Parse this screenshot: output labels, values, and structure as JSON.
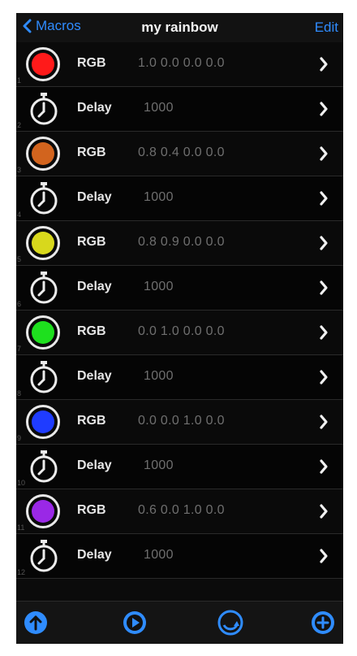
{
  "nav": {
    "back_label": "Macros",
    "title": "my rainbow",
    "edit_label": "Edit"
  },
  "rows": [
    {
      "index": "1",
      "label": "RGB",
      "value": "1.0 0.0 0.0 0.0",
      "color": "#ff1a1a",
      "icon": "color-swatch"
    },
    {
      "index": "2",
      "label": "Delay",
      "value": "1000",
      "icon": "stopwatch-icon"
    },
    {
      "index": "3",
      "label": "RGB",
      "value": "0.8 0.4 0.0 0.0",
      "color": "#d2641e",
      "icon": "color-swatch"
    },
    {
      "index": "4",
      "label": "Delay",
      "value": "1000",
      "icon": "stopwatch-icon"
    },
    {
      "index": "5",
      "label": "RGB",
      "value": "0.8 0.9 0.0 0.0",
      "color": "#d8d81c",
      "icon": "color-swatch"
    },
    {
      "index": "6",
      "label": "Delay",
      "value": "1000",
      "icon": "stopwatch-icon"
    },
    {
      "index": "7",
      "label": "RGB",
      "value": "0.0 1.0 0.0 0.0",
      "color": "#1ee01e",
      "icon": "color-swatch"
    },
    {
      "index": "8",
      "label": "Delay",
      "value": "1000",
      "icon": "stopwatch-icon"
    },
    {
      "index": "9",
      "label": "RGB",
      "value": "0.0 0.0 1.0 0.0",
      "color": "#1f3cff",
      "icon": "color-swatch"
    },
    {
      "index": "10",
      "label": "Delay",
      "value": "1000",
      "icon": "stopwatch-icon"
    },
    {
      "index": "11",
      "label": "RGB",
      "value": "0.6 0.0 1.0 0.0",
      "color": "#9a28e6",
      "icon": "color-swatch"
    },
    {
      "index": "12",
      "label": "Delay",
      "value": "1000",
      "icon": "stopwatch-icon"
    }
  ],
  "toolbar": {
    "buttons": [
      {
        "name": "upload-button",
        "icon": "arrow-up-circle-icon"
      },
      {
        "name": "play-button",
        "icon": "play-circle-icon"
      },
      {
        "name": "loop-button",
        "icon": "loop-icon"
      },
      {
        "name": "add-button",
        "icon": "plus-circle-icon"
      }
    ]
  },
  "colors": {
    "accent": "#2f8cff",
    "background": "#0b0b0b",
    "text": "#e6e6e6",
    "muted": "#6f6f6f"
  }
}
